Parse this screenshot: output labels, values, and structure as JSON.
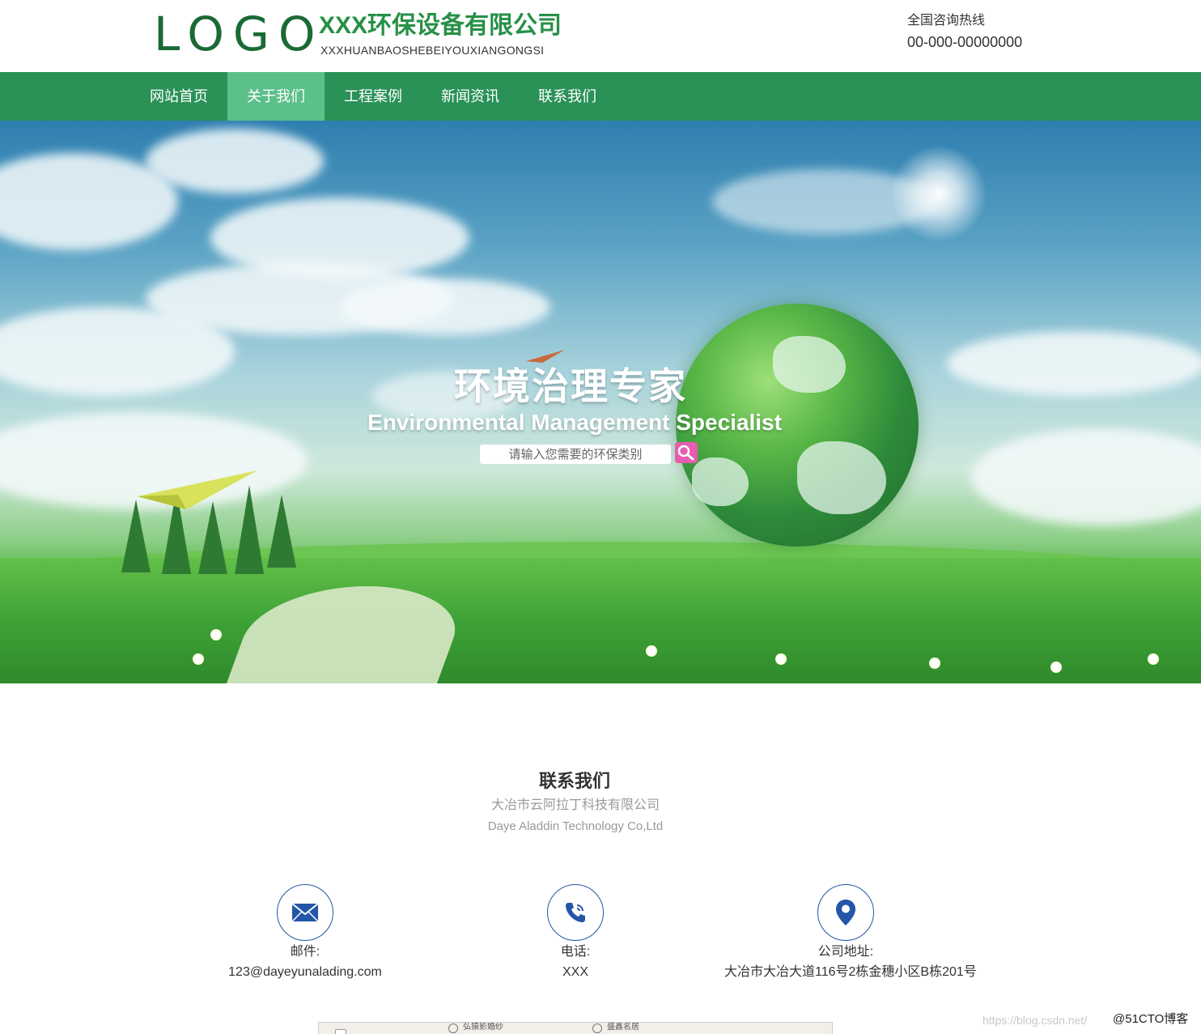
{
  "header": {
    "logo_text": "LOGO",
    "company_name_cn": "XXX环保设备有限公司",
    "company_name_en": "XXXHUANBAOSHEBEIYOUXIANGONGSI",
    "hotline_label": "全国咨询热线",
    "hotline_number": "00-000-00000000"
  },
  "nav": {
    "items": [
      {
        "label": "网站首页",
        "active": false
      },
      {
        "label": "关于我们",
        "active": true
      },
      {
        "label": "工程案例",
        "active": false
      },
      {
        "label": "新闻资讯",
        "active": false
      },
      {
        "label": "联系我们",
        "active": false
      }
    ],
    "background": "#2a9157",
    "active_background": "#5cc08a"
  },
  "banner": {
    "title": "环境治理专家",
    "subtitle": "Environmental Management Specialist",
    "search": {
      "placeholder": "请输入您需要的环保类别",
      "button_icon": "search-icon",
      "button_color": "#e75bb0"
    }
  },
  "contact": {
    "title": "联系我们",
    "company_cn": "大冶市云阿拉丁科技有限公司",
    "company_en": "Daye Aladdin Technology Co,Ltd",
    "items": [
      {
        "icon": "envelope-icon",
        "label": "邮件:",
        "value": "123@dayeyunalading.com"
      },
      {
        "icon": "phone-icon",
        "label": "电话:",
        "value": "XXX"
      },
      {
        "icon": "location-pin-icon",
        "label": "公司地址:",
        "value": "大冶市大冶大道116号2栋金穗小区B栋201号"
      }
    ],
    "icon_color": "#2456a8"
  },
  "map": {
    "labels": [
      "弘猿影婚纱",
      "盛鑫名居"
    ]
  },
  "watermarks": {
    "url": "https://blog.csdn.net/",
    "site": "@51CTO博客"
  }
}
